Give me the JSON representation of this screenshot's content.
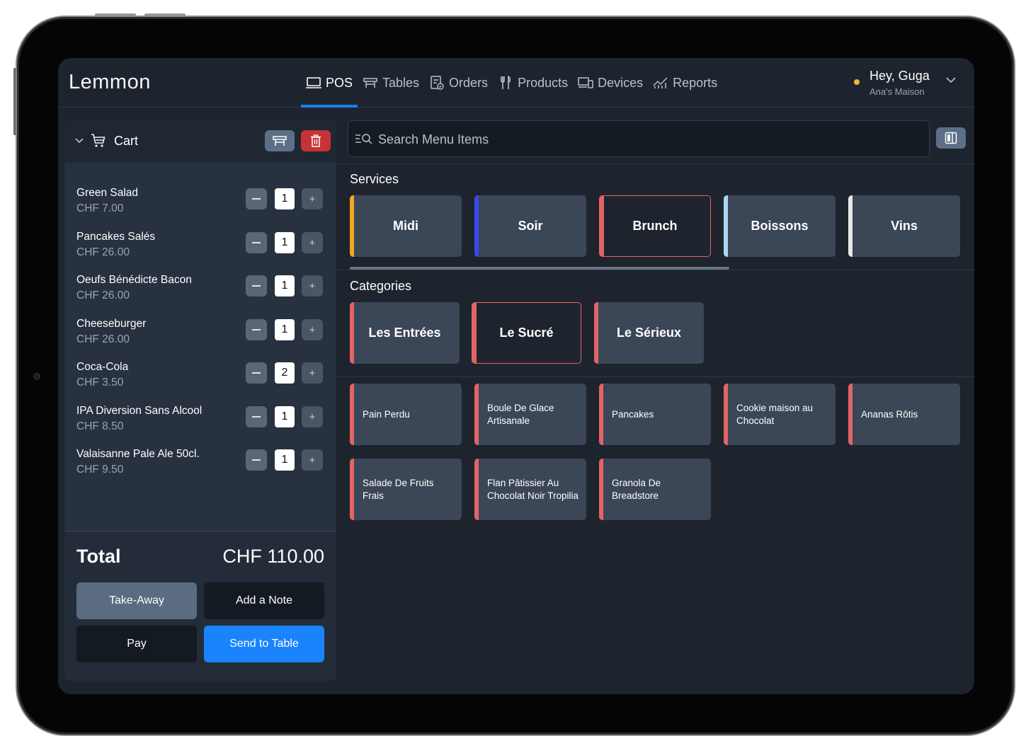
{
  "brand": "Lemmon",
  "nav": [
    {
      "label": "POS",
      "icon": "laptop-icon",
      "active": true
    },
    {
      "label": "Tables",
      "icon": "table-icon",
      "active": false
    },
    {
      "label": "Orders",
      "icon": "orders-icon",
      "active": false
    },
    {
      "label": "Products",
      "icon": "cutlery-icon",
      "active": false
    },
    {
      "label": "Devices",
      "icon": "devices-icon",
      "active": false
    },
    {
      "label": "Reports",
      "icon": "chart-icon",
      "active": false
    }
  ],
  "user": {
    "greeting": "Hey, Guga",
    "venue": "Ana's Maison",
    "status_color": "#f0b43c"
  },
  "cart": {
    "title": "Cart",
    "items": [
      {
        "name": "Green Salad",
        "price": "CHF 7.00",
        "qty": "1"
      },
      {
        "name": "Pancakes Salés",
        "price": "CHF 26.00",
        "qty": "1"
      },
      {
        "name": "Oeufs Bénédicte Bacon",
        "price": "CHF 26.00",
        "qty": "1"
      },
      {
        "name": "Cheeseburger",
        "price": "CHF 26.00",
        "qty": "1"
      },
      {
        "name": "Coca-Cola",
        "price": "CHF 3.50",
        "qty": "2"
      },
      {
        "name": "IPA Diversion Sans Alcool",
        "price": "CHF 8.50",
        "qty": "1"
      },
      {
        "name": "Valaisanne Pale Ale 50cl.",
        "price": "CHF 9.50",
        "qty": "1"
      }
    ],
    "total_label": "Total",
    "total_value": "CHF 110.00",
    "buttons": {
      "take_away": "Take-Away",
      "add_note": "Add a Note",
      "pay": "Pay",
      "send_to_table": "Send to Table"
    }
  },
  "search": {
    "placeholder": "Search Menu Items"
  },
  "services": {
    "title": "Services",
    "items": [
      {
        "label": "Midi",
        "color": "#f5a623"
      },
      {
        "label": "Soir",
        "color": "#3a47f0"
      },
      {
        "label": "Brunch",
        "color": "#e26465",
        "selected": true
      },
      {
        "label": "Boissons",
        "color": "#a8d8f0"
      },
      {
        "label": "Vins",
        "color": "#e8e8e8"
      }
    ]
  },
  "categories": {
    "title": "Categories",
    "items": [
      {
        "label": "Les Entrées",
        "color": "#e26465"
      },
      {
        "label": "Le Sucré",
        "color": "#e26465",
        "selected": true
      },
      {
        "label": "Le Sérieux",
        "color": "#e26465"
      }
    ]
  },
  "products": [
    {
      "label": "Pain Perdu"
    },
    {
      "label": "Boule De Glace Artisanale"
    },
    {
      "label": "Pancakes"
    },
    {
      "label": "Cookie maison au Chocolat"
    },
    {
      "label": "Ananas Rôtis"
    },
    {
      "label": "Salade De Fruits Frais"
    },
    {
      "label": "Flan Pâtissier Au Chocolat Noir Tropilia"
    },
    {
      "label": "Granola De Breadstore"
    }
  ],
  "colors": {
    "accent": "#1a84ff",
    "danger": "#c73236",
    "product_bar": "#e26465"
  }
}
